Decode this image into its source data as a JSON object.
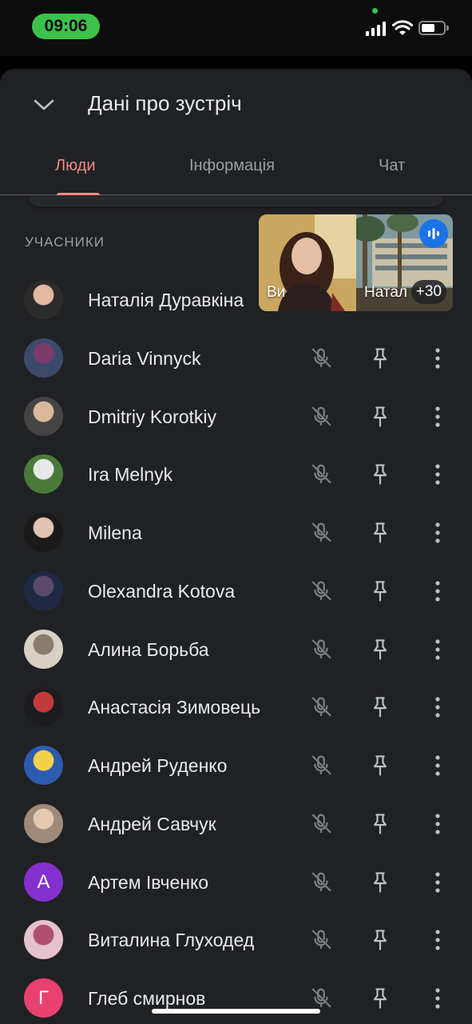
{
  "status_bar": {
    "time": "09:06"
  },
  "header": {
    "title": "Дані про зустріч"
  },
  "tabs": [
    {
      "label": "Люди"
    },
    {
      "label": "Інформація"
    },
    {
      "label": "Чат"
    }
  ],
  "participants": {
    "section_label": "УЧАСНИКИ",
    "items": [
      {
        "name": "Наталія Дуравкіна"
      },
      {
        "name": "Daria Vinnyck"
      },
      {
        "name": "Dmitriy Korotkiy"
      },
      {
        "name": "Ira Melnyk"
      },
      {
        "name": "Milena"
      },
      {
        "name": "Olexandra Kotova"
      },
      {
        "name": "Алина Борьба"
      },
      {
        "name": "Анастасія Зимовець"
      },
      {
        "name": "Андрей Руденко"
      },
      {
        "name": "Андрей Савчук"
      },
      {
        "name": "Артем Івченко",
        "initial": "А",
        "color": "#8430ce"
      },
      {
        "name": "Виталина Глуходед"
      },
      {
        "name": "Глеб смирнов",
        "initial": "Г",
        "color": "#e8416f"
      }
    ]
  },
  "pip": {
    "self_label": "Ви",
    "other_label": "Натал",
    "more_count": "+30"
  },
  "colors": {
    "accent": "#f28b82",
    "background": "#202124",
    "speaking": "#1a73e8"
  }
}
